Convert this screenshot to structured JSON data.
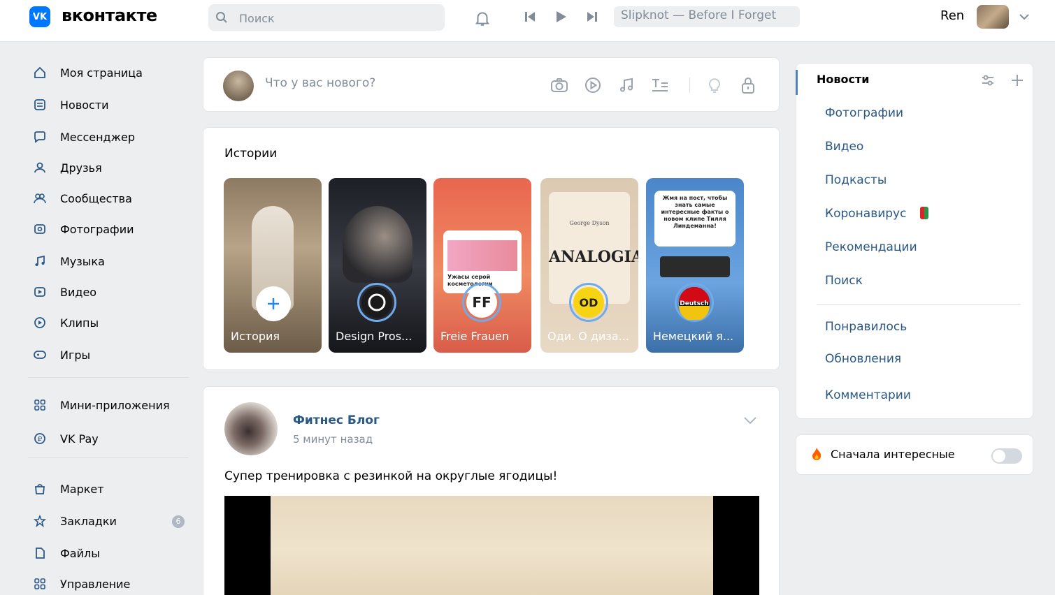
{
  "header": {
    "logo_mark": "VK",
    "logo_text": "вконтакте",
    "search_placeholder": "Поиск",
    "now_playing": "Slipknot — Before I Forget",
    "user_name": "Ren"
  },
  "sidebar": {
    "items": [
      {
        "label": "Моя страница",
        "icon": "home-icon"
      },
      {
        "label": "Новости",
        "icon": "news-icon"
      },
      {
        "label": "Мессенджер",
        "icon": "message-icon"
      },
      {
        "label": "Друзья",
        "icon": "friends-icon"
      },
      {
        "label": "Сообщества",
        "icon": "groups-icon"
      },
      {
        "label": "Фотографии",
        "icon": "photo-icon"
      },
      {
        "label": "Музыка",
        "icon": "music-icon"
      },
      {
        "label": "Видео",
        "icon": "video-icon"
      },
      {
        "label": "Клипы",
        "icon": "clips-icon"
      },
      {
        "label": "Игры",
        "icon": "games-icon"
      },
      {
        "label": "Мини-приложения",
        "icon": "apps-icon"
      },
      {
        "label": "VK Pay",
        "icon": "pay-icon"
      },
      {
        "label": "Маркет",
        "icon": "market-icon"
      },
      {
        "label": "Закладки",
        "icon": "bookmark-icon"
      },
      {
        "label": "Файлы",
        "icon": "files-icon"
      },
      {
        "label": "Управление",
        "icon": "manage-icon"
      }
    ],
    "bookmarks_badge": "6"
  },
  "composer": {
    "placeholder": "Что у вас нового?"
  },
  "stories": {
    "title": "Истории",
    "items": [
      {
        "caption": "История"
      },
      {
        "caption": "Design Pros..."
      },
      {
        "caption": "Freie Frauen"
      },
      {
        "caption": "Оди. О диза..."
      },
      {
        "caption": "Немецкий я..."
      }
    ],
    "story_texts": {
      "s3_badge": "Ужасы серой косметологии",
      "s4_title": "ANALOGIA",
      "s4_author": "George Dyson",
      "s4_logo": "OD",
      "s5_badge": "Deutsch",
      "s5_text": "Жмя на пост, чтобы знать самые интересные факты о новом клипе Тилля Линдеманна!"
    }
  },
  "post": {
    "author": "Фитнес Блог",
    "time": "5 минут назад",
    "text": "Супер тренировка с резинкой на округлые ягодицы!"
  },
  "right_menu": {
    "title": "Новости",
    "items": [
      "Фотографии",
      "Видео",
      "Подкасты",
      "Коронавирус",
      "Рекомендации",
      "Поиск"
    ],
    "items2": [
      "Понравилось",
      "Обновления",
      "Комментарии"
    ],
    "sort_label": "Сначала интересные"
  }
}
